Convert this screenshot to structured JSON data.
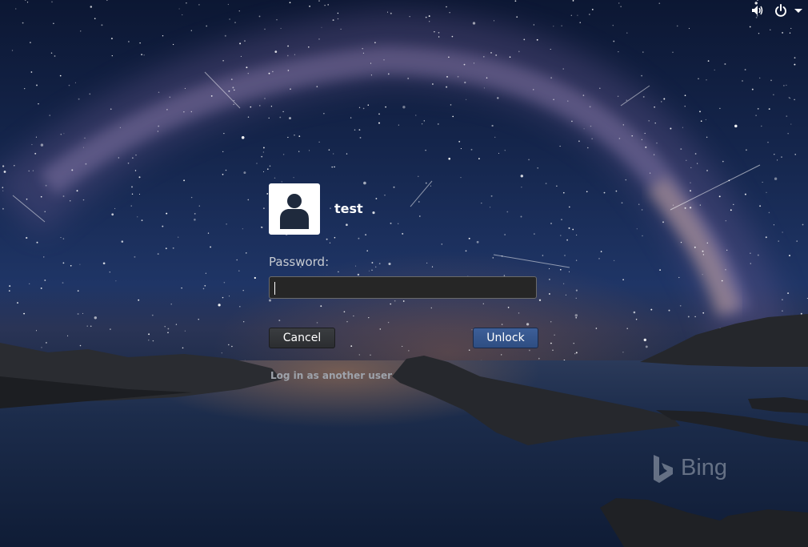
{
  "top_bar": {
    "icons": [
      "volume-icon",
      "power-icon",
      "chevron-down-icon"
    ]
  },
  "user": {
    "name": "test",
    "avatar_icon": "user-avatar-icon"
  },
  "password": {
    "label": "Password:",
    "value": ""
  },
  "buttons": {
    "cancel_label": "Cancel",
    "unlock_label": "Unlock"
  },
  "other_user_link": "Log in as another user",
  "watermark": {
    "text": "Bing"
  },
  "colors": {
    "unlock_button": "#2e4d82",
    "cancel_button": "#2b2d30",
    "password_field_bg": "#262626"
  }
}
